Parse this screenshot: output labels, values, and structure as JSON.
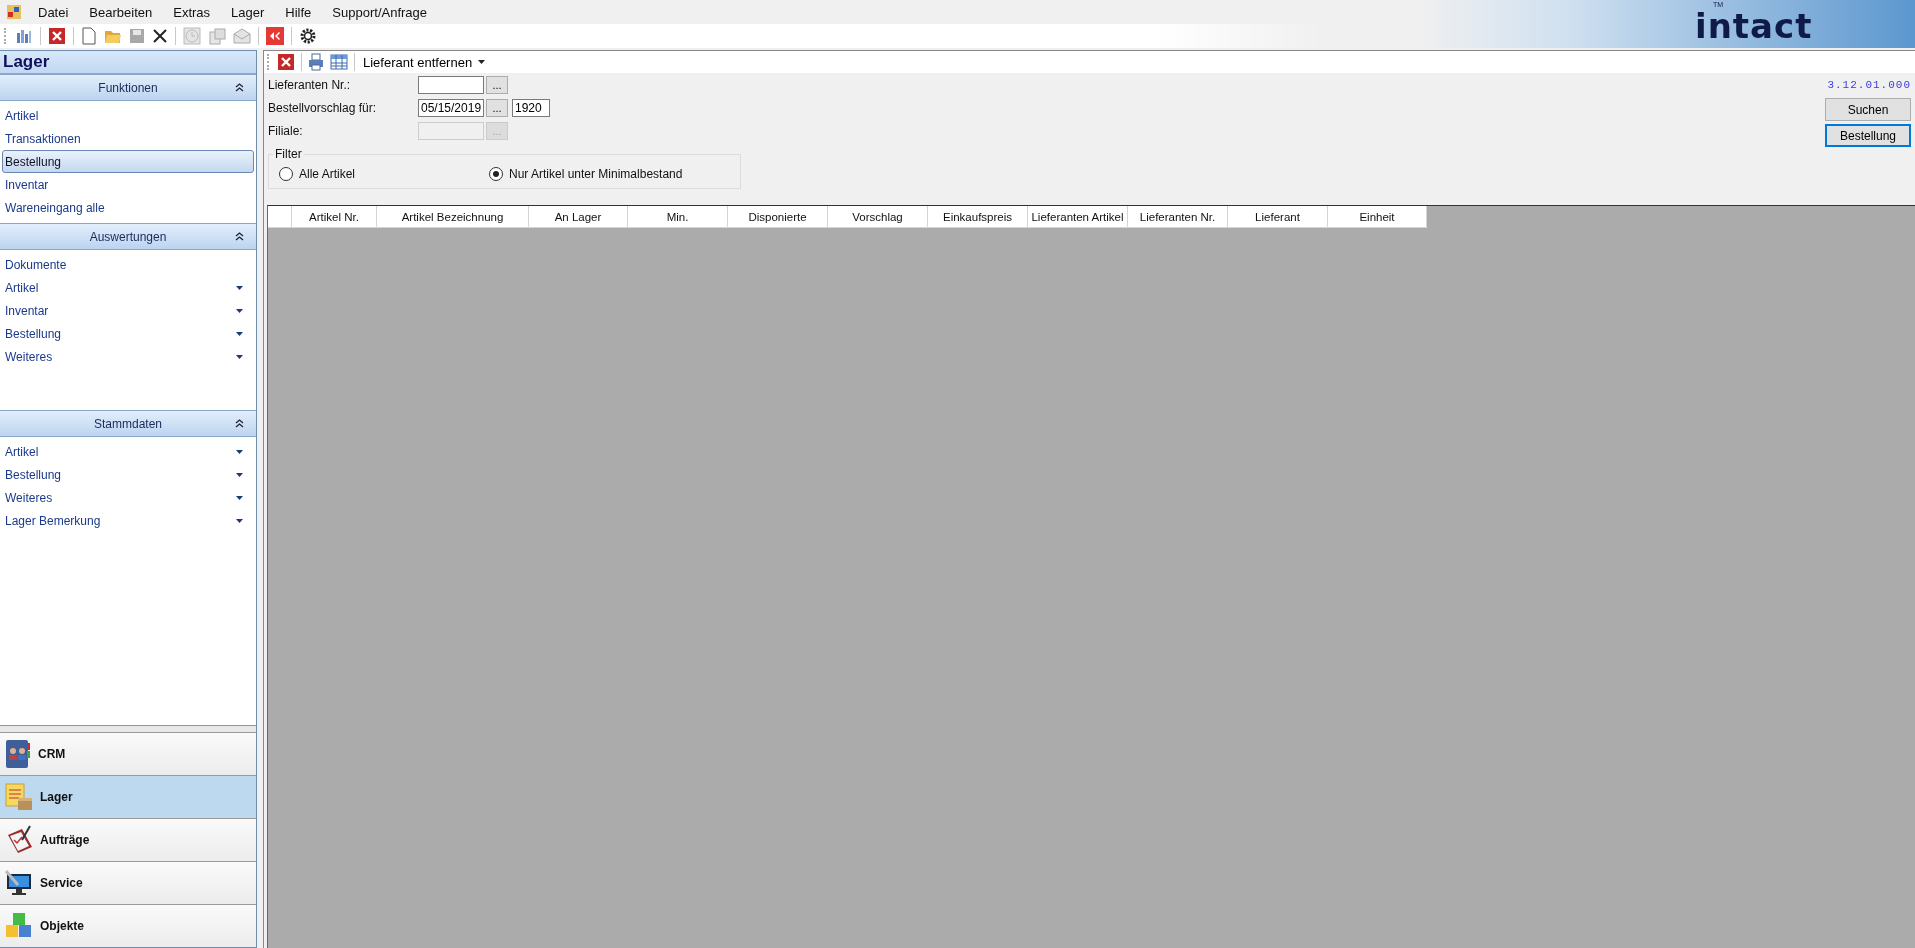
{
  "menu": [
    "Datei",
    "Bearbeiten",
    "Extras",
    "Lager",
    "Hilfe",
    "Support/Anfrage"
  ],
  "logo": {
    "text": "intact",
    "mark": "TM"
  },
  "sidebar": {
    "title": "Lager",
    "sections": [
      {
        "title": "Funktionen",
        "expanded": true,
        "items": [
          {
            "label": "Artikel",
            "kind": "link",
            "selected": false
          },
          {
            "label": "Transaktionen",
            "kind": "link",
            "selected": false
          },
          {
            "label": "Bestellung",
            "kind": "link",
            "selected": true
          },
          {
            "label": "Inventar",
            "kind": "link",
            "selected": false
          },
          {
            "label": "Wareneingang alle",
            "kind": "link",
            "selected": false
          }
        ]
      },
      {
        "title": "Auswertungen",
        "expanded": true,
        "items": [
          {
            "label": "Dokumente",
            "kind": "link",
            "selected": false
          },
          {
            "label": "Artikel",
            "kind": "dropdown",
            "selected": false
          },
          {
            "label": "Inventar",
            "kind": "dropdown",
            "selected": false
          },
          {
            "label": "Bestellung",
            "kind": "dropdown",
            "selected": false
          },
          {
            "label": "Weiteres",
            "kind": "dropdown",
            "selected": false
          }
        ]
      },
      {
        "title": "Stammdaten",
        "expanded": true,
        "items": [
          {
            "label": "Artikel",
            "kind": "dropdown",
            "selected": false
          },
          {
            "label": "Bestellung",
            "kind": "dropdown",
            "selected": false
          },
          {
            "label": "Weiteres",
            "kind": "dropdown",
            "selected": false
          },
          {
            "label": "Lager Bemerkung",
            "kind": "dropdown",
            "selected": false
          }
        ]
      }
    ]
  },
  "modules": [
    {
      "label": "CRM",
      "selected": false
    },
    {
      "label": "Lager",
      "selected": true
    },
    {
      "label": "Aufträge",
      "selected": false
    },
    {
      "label": "Service",
      "selected": false
    },
    {
      "label": "Objekte",
      "selected": false
    }
  ],
  "toolbar": {
    "dropdown": "Lieferant entfernen"
  },
  "form": {
    "supplier": {
      "label": "Lieferanten Nr.:",
      "browse": "..."
    },
    "proposal": {
      "label": "Bestellvorschlag für:",
      "value": "05/15/2019",
      "browse": "...",
      "year": "1920"
    },
    "branch": {
      "label": "Filiale:",
      "disabled": true,
      "browse": "..."
    },
    "filter": {
      "title": "Filter",
      "options": [
        {
          "label": "Alle Artikel",
          "selected": false
        },
        {
          "label": "Nur Artikel unter Minimalbestand",
          "selected": true
        }
      ]
    }
  },
  "version": "3.12.01.000",
  "buttons": [
    {
      "label": "Suchen",
      "focused": false
    },
    {
      "label": "Bestellung",
      "focused": true
    }
  ],
  "table": {
    "columns": [
      "Artikel Nr.",
      "Artikel Bezeichnung",
      "An Lager",
      "Min.",
      "Disponierte",
      "Vorschlag",
      "Einkaufspreis",
      "Lieferanten Artikel",
      "Lieferanten Nr.",
      "Lieferant",
      "Einheit"
    ]
  }
}
